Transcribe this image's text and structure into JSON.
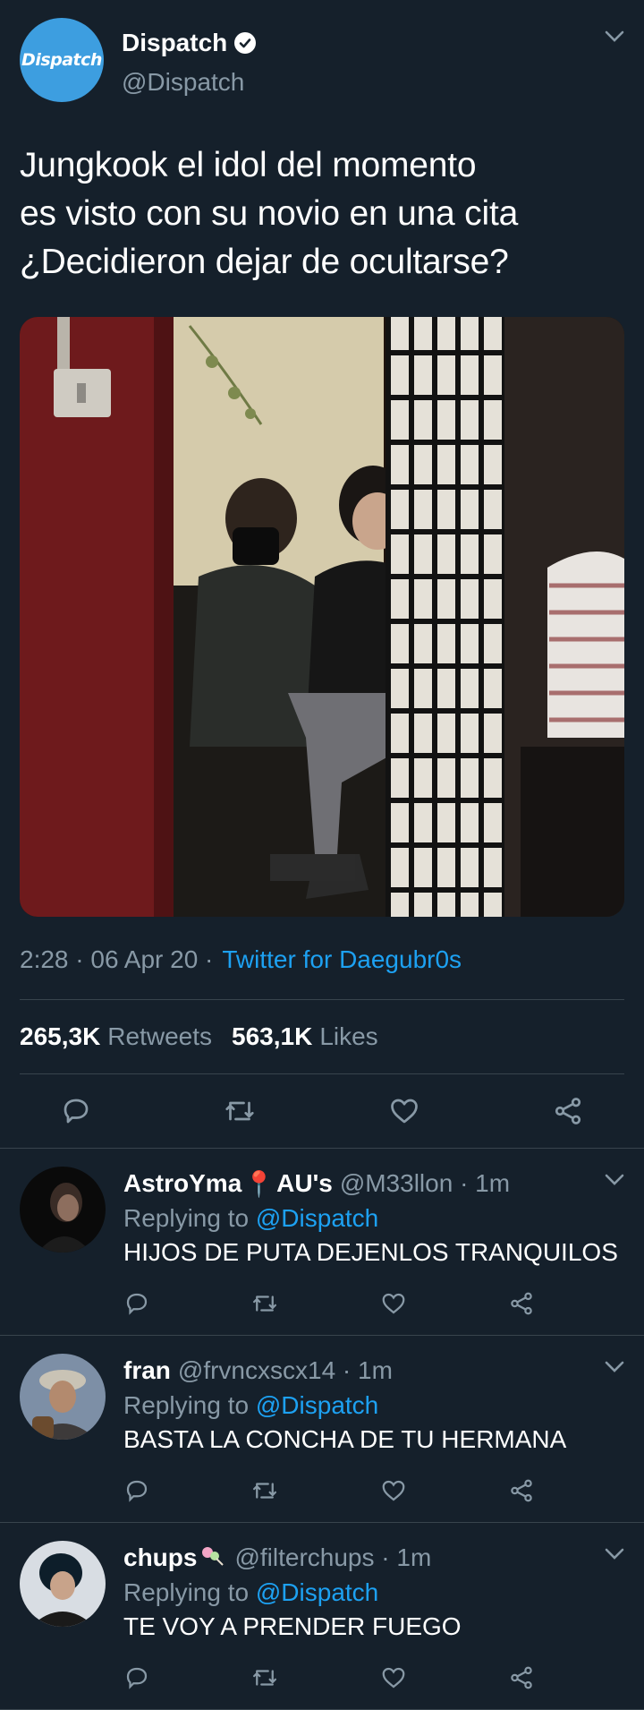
{
  "tweet": {
    "avatar_text": "Dispatch",
    "display_name": "Dispatch",
    "handle": "@Dispatch",
    "text_lines": [
      "Jungkook el idol del momento",
      "es visto con su novio en una cita",
      "¿Decidieron dejar de ocultarse?"
    ],
    "time": "2:28",
    "date": "06 Apr 20",
    "source": "Twitter for Daegubr0s",
    "retweets_count": "265,3K",
    "retweets_label": "Retweets",
    "likes_count": "563,1K",
    "likes_label": "Likes"
  },
  "replies": [
    {
      "name": "AstroYma",
      "name_suffix": "AU's",
      "handle_time": "@M33llon · 1m",
      "replying_label": "Replying to",
      "replying_to": "@Dispatch",
      "text": "HIJOS DE PUTA DEJENLOS TRANQUILOS"
    },
    {
      "name": "fran",
      "handle_time": "@frvncxscx14 · 1m",
      "replying_label": "Replying to",
      "replying_to": "@Dispatch",
      "text": "BASTA LA CONCHA DE TU HERMANA"
    },
    {
      "name": "chups",
      "handle_time": "@filterchups · 1m",
      "replying_label": "Replying to",
      "replying_to": "@Dispatch",
      "text": "TE VOY A PRENDER FUEGO"
    }
  ],
  "colors": {
    "background": "#15202b",
    "accent": "#1da1f2",
    "muted": "#8899a6",
    "divider": "#38444d"
  }
}
